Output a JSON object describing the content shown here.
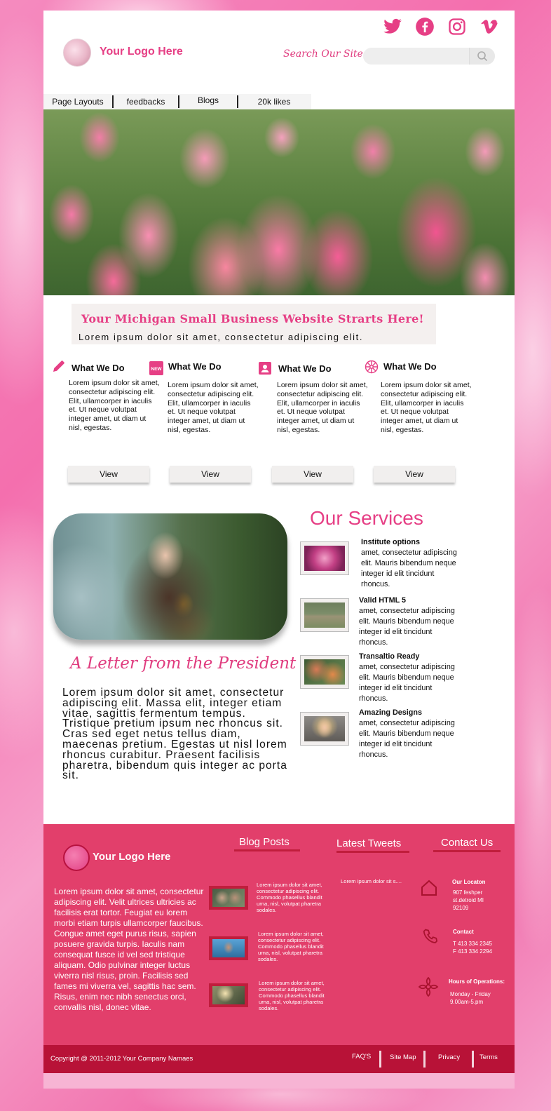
{
  "header": {
    "logo_text": "Your Logo Here",
    "search_label": "Search Our Site",
    "search_placeholder": "",
    "social_icons": [
      "twitter-icon",
      "facebook-icon",
      "instagram-icon",
      "vimeo-icon"
    ]
  },
  "nav": {
    "items": [
      {
        "label": "Page Layouts"
      },
      {
        "label": "feedbacks"
      },
      {
        "label": "Blogs"
      },
      {
        "label": "20k likes"
      }
    ]
  },
  "tagline": {
    "title": "Your  Michigan Small  Business Website Strarts Here!",
    "subtitle": "Lorem ipsum dolor sit amet, consectetur adipiscing elit."
  },
  "cards": [
    {
      "icon": "pencil-icon",
      "title": "What We Do",
      "body": "Lorem ipsum dolor sit amet, consectetur adipiscing elit. Elit, ullamcorper in iaculis et. Ut neque volutpat integer amet, ut diam ut nisl, egestas.",
      "button": "View"
    },
    {
      "icon": "new-badge-icon",
      "title": "What We Do",
      "body": "Lorem ipsum dolor sit amet, consectetur adipiscing elit. Elit, ullamcorper in iaculis et. Ut neque volutpat integer amet, ut diam ut nisl, egestas.",
      "button": "View"
    },
    {
      "icon": "contact-card-icon",
      "title": "What We Do",
      "body": "Lorem ipsum dolor sit amet, consectetur adipiscing elit. Elit, ullamcorper in iaculis et. Ut neque volutpat integer amet, ut diam ut nisl, egestas.",
      "button": "View"
    },
    {
      "icon": "flower-icon",
      "title": "What We Do",
      "body": "Lorem ipsum dolor sit amet, consectetur adipiscing elit. Elit, ullamcorper in iaculis et. Ut neque volutpat integer amet, ut diam ut nisl, egestas.",
      "button": "View"
    }
  ],
  "letter": {
    "title": "A Letter from the President",
    "body": "Lorem ipsum dolor sit amet, consectetur adipiscing elit. Massa elit, integer etiam vitae, sagittis fermentum tempus. Tristique pretium ipsum nec rhoncus sit. Cras sed eget netus tellus diam, maecenas pretium. Egestas ut nisl lorem rhoncus curabitur. Praesent facilisis pharetra, bibendum quis integer ac porta sit."
  },
  "services": {
    "title": "Our Services",
    "items": [
      {
        "title": "Institute options",
        "body": "amet, consectetur adipiscing elit. Mauris bibendum neque integer id elit tincidunt rhoncus."
      },
      {
        "title": "Valid HTML 5",
        "body": "amet, consectetur adipiscing elit. Mauris bibendum neque integer id elit tincidunt rhoncus."
      },
      {
        "title": "Transaltio Ready",
        "body": " amet, consectetur adipiscing elit. Mauris bibendum neque integer id elit tincidunt rhoncus."
      },
      {
        "title": "Amazing Designs",
        "body": "amet, consectetur adipiscing elit. Mauris bibendum neque integer id elit tincidunt rhoncus."
      }
    ]
  },
  "footer": {
    "logo_text": "Your Logo Here",
    "paragraph": "Lorem ipsum dolor sit amet, consectetur adipiscing elit. Velit ultrices ultricies ac facilisis erat tortor. Feugiat eu lorem morbi etiam turpis ullamcorper faucibus. Congue amet eget purus risus, sapien posuere gravida turpis. Iaculis nam consequat fusce id vel sed tristique aliquam. Odio pulvinar integer luctus viverra nisl risus, proin. Facilisis sed fames mi viverra vel, sagittis hac sem. Risus, enim nec nibh senectus orci, convallis nisl, donec vitae.",
    "blog_heading": "Blog Posts",
    "tweets_heading": "Latest Tweets",
    "contact_heading": "Contact Us",
    "blog_posts": [
      {
        "text": "Lorem ipsum dolor sit amet, consectetur adipiscing elit. Commodo phasellus blandit urna, nisl, volutpat pharetra sodales."
      },
      {
        "text": "Lorem ipsum dolor sit amet, consectetur adipiscing elit. Commodo phasellus blandit urna, nisl, volutpat pharetra sodales."
      },
      {
        "text": "Lorem ipsum dolor sit amet, consectetur adipiscing elit. Commodo phasellus blandit urna, nisl, volutpat pharetra sodales."
      }
    ],
    "tweet": "Lorem ipsum dolor sit s....",
    "location": {
      "title": "Our Locaton",
      "text": "907 feshper st.detroid MI 92109"
    },
    "contact": {
      "title": "Contact",
      "phone": "T 413 334 2345",
      "fax": "F 413 334 2294"
    },
    "hours": {
      "title": "Hours of Operations:",
      "days": "Monday - Friday",
      "time": "9.00am-5.pm"
    },
    "copyright": "Copyright @ 2011-2012 Your Company Namaes",
    "links": [
      {
        "label": "FAQ'S"
      },
      {
        "label": "Site Map"
      },
      {
        "label": "Privacy"
      },
      {
        "label": "Terms"
      }
    ]
  },
  "colors": {
    "brand_pink": "#e63f85",
    "footer_bg": "#e23f6b",
    "footer_bar": "#b81237"
  }
}
